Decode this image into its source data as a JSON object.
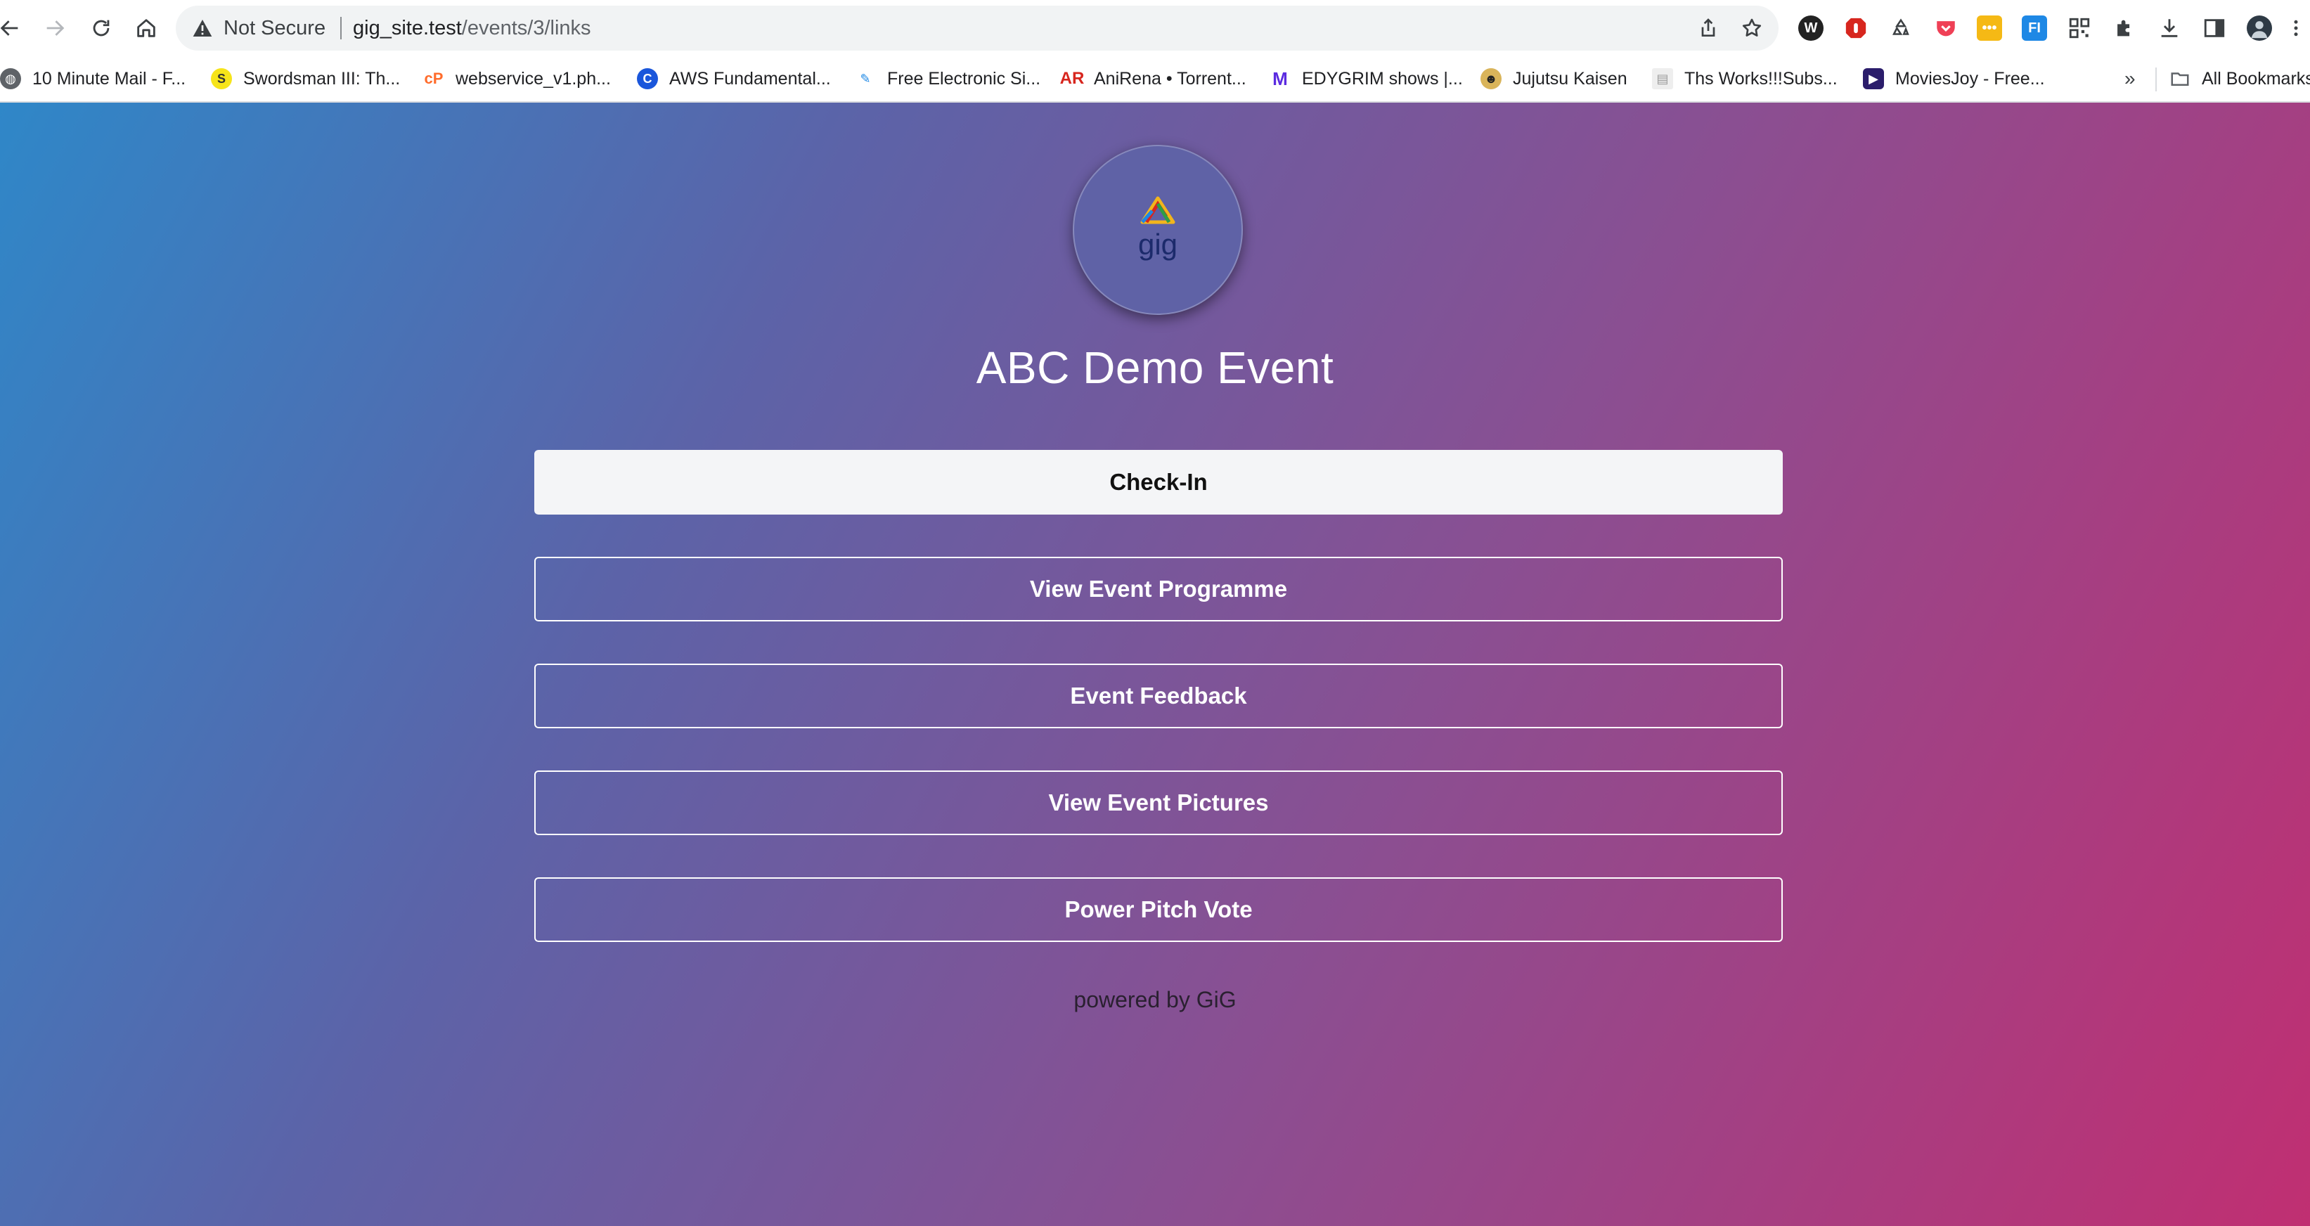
{
  "browser": {
    "security_label": "Not Secure",
    "url_host": "gig_site.test",
    "url_path": "/events/3/links"
  },
  "bookmarks": {
    "items": [
      {
        "label": "10 Minute Mail - F...",
        "icon": "globe-icon"
      },
      {
        "label": "Swordsman III: Th...",
        "icon": "s-badge-icon"
      },
      {
        "label": "webservice_v1.ph...",
        "icon": "cpanel-icon"
      },
      {
        "label": "AWS Fundamental...",
        "icon": "coursera-icon"
      },
      {
        "label": "Free Electronic Si...",
        "icon": "pen-icon"
      },
      {
        "label": "AniRena • Torrent...",
        "icon": "ar-icon"
      },
      {
        "label": "EDYGRIM shows |...",
        "icon": "m-icon"
      },
      {
        "label": "Jujutsu Kaisen",
        "icon": "anime-icon"
      },
      {
        "label": "Ths Works!!!Subs...",
        "icon": "page-icon"
      },
      {
        "label": "MoviesJoy - Free...",
        "icon": "movie-icon"
      }
    ],
    "overflow": "»",
    "all_bookmarks": "All Bookmarks"
  },
  "event": {
    "title": "ABC Demo Event",
    "logo_text": "gig",
    "links": [
      {
        "label": "Check-In",
        "style": "primary"
      },
      {
        "label": "View Event Programme",
        "style": "outline"
      },
      {
        "label": "Event Feedback",
        "style": "outline"
      },
      {
        "label": "View Event Pictures",
        "style": "outline"
      },
      {
        "label": "Power Pitch Vote",
        "style": "outline"
      }
    ],
    "powered_by": "powered by GiG"
  },
  "colors": {
    "gradient_start": "#2f87c8",
    "gradient_mid": "#8a4f92",
    "gradient_end": "#c02f72",
    "primary_button_bg": "#f4f5f7"
  }
}
